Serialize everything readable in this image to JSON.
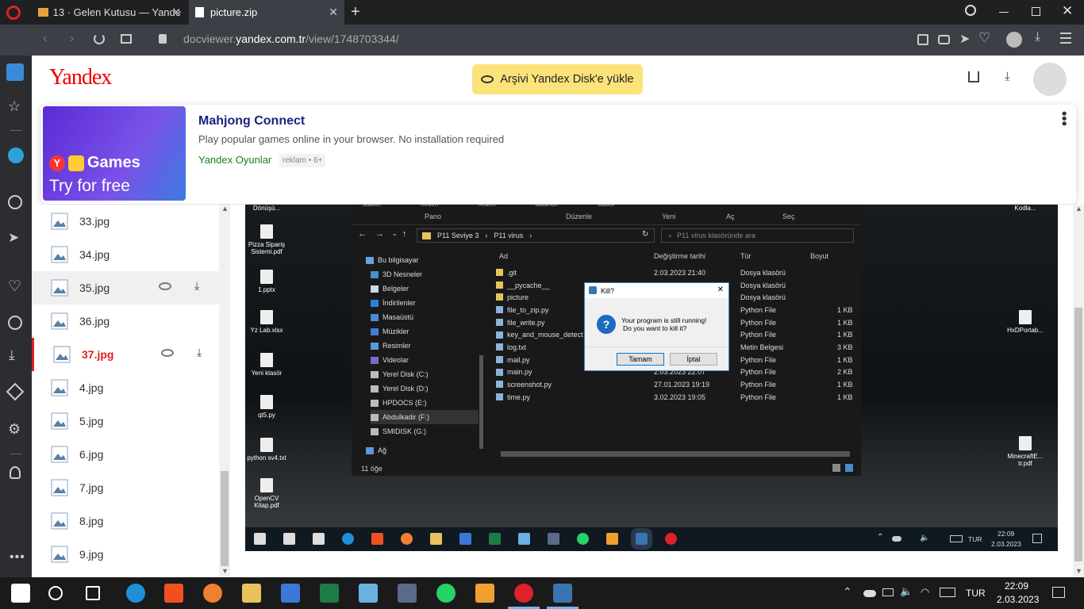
{
  "browser": {
    "tabs": [
      {
        "label": "13 · Gelen Kutusu — Yande",
        "active": false
      },
      {
        "label": "picture.zip",
        "active": true
      }
    ],
    "url_prefix": "docviewer.",
    "url_domain": "yandex.com.tr",
    "url_path": "/view/1748703344/"
  },
  "header": {
    "logo": "Yandex",
    "save_button": "Arşivi Yandex Disk'e yükle"
  },
  "ad": {
    "title": "Mahjong Connect",
    "description": "Play popular games online in your browser. No installation required",
    "source": "Yandex Oyunlar",
    "badge": "reklam • 6+",
    "image_brand": "Games",
    "image_cta": "Try for free"
  },
  "files": [
    {
      "name": "33.jpg"
    },
    {
      "name": "34.jpg"
    },
    {
      "name": "35.jpg",
      "state": "hover"
    },
    {
      "name": "36.jpg"
    },
    {
      "name": "37.jpg",
      "state": "current"
    },
    {
      "name": "4.jpg"
    },
    {
      "name": "5.jpg"
    },
    {
      "name": "6.jpg"
    },
    {
      "name": "7.jpg"
    },
    {
      "name": "8.jpg"
    },
    {
      "name": "9.jpg"
    }
  ],
  "screenshot": {
    "desktop_left": [
      {
        "label": "Dönüşü..."
      },
      {
        "label": "Pizza Sipariş Sistemi.pdf"
      },
      {
        "label": "1.pptx"
      },
      {
        "label": "Yz Lab.xlsx"
      },
      {
        "label": "Yeni klasör"
      },
      {
        "label": "qt5.py"
      },
      {
        "label": "python sv4.txt"
      },
      {
        "label": "OpenCV Kitap.pdf"
      }
    ],
    "desktop_right": [
      {
        "label": "Kodla..."
      },
      {
        "label": "HxDPortab..."
      },
      {
        "label": "MinecraftE... tr.pdf"
      }
    ],
    "ribbon_groups": [
      "Pano",
      "Düzenle",
      "Yeni",
      "Aç",
      "Seç"
    ],
    "ribbon_top": [
      "sabitle",
      "neden",
      "neden",
      "adlandır",
      "klasör"
    ],
    "path": [
      "P11 Seviye 3",
      "P11 virus"
    ],
    "search_placeholder": "P11 virus klasöründe ara",
    "nav": [
      "Bu bilgisayar",
      "3D Nesneler",
      "Belgeler",
      "İndirilenler",
      "Masaüstü",
      "Müzikler",
      "Resimler",
      "Videolar",
      "Yerel Disk (C:)",
      "Yerel Disk (D:)",
      "HPDOCS (E:)",
      "Abdulkadir (F:)",
      "SMIDISK (G:)",
      "Ağ"
    ],
    "columns": [
      "Ad",
      "Değiştirme tarihi",
      "Tür",
      "Boyut"
    ],
    "rows": [
      {
        "name": ".git",
        "date": "2.03.2023 21:40",
        "type": "Dosya klasörü",
        "size": ""
      },
      {
        "name": "__pycache__",
        "date": "",
        "type": "Dosya klasörü",
        "size": ""
      },
      {
        "name": "picture",
        "date": "",
        "type": "Dosya klasörü",
        "size": ""
      },
      {
        "name": "file_to_zip.py",
        "date": "",
        "type": "Python File",
        "size": "1 KB"
      },
      {
        "name": "file_write.py",
        "date": "",
        "type": "Python File",
        "size": "1 KB"
      },
      {
        "name": "key_and_mouse_detect",
        "date": "",
        "type": "Python File",
        "size": "1 KB"
      },
      {
        "name": "log.txt",
        "date": "",
        "type": "Metin Belgesi",
        "size": "3 KB"
      },
      {
        "name": "mail.py",
        "date": "",
        "type": "Python File",
        "size": "1 KB"
      },
      {
        "name": "main.py",
        "date": "2.03.2023 22:07",
        "type": "Python File",
        "size": "2 KB"
      },
      {
        "name": "screenshot.py",
        "date": "27.01.2023 19:19",
        "type": "Python File",
        "size": "1 KB"
      },
      {
        "name": "time.py",
        "date": "3.02.2023 19:05",
        "type": "Python File",
        "size": "1 KB"
      }
    ],
    "item_count": "11 öğe",
    "dialog": {
      "title": "Kill?",
      "message_line1": "Your program is still running!",
      "message_line2": "Do you want to kill it?",
      "ok": "Tamam",
      "cancel": "İptal"
    },
    "taskbar_lang": "TUR",
    "taskbar_time": "22:09",
    "taskbar_date": "2.03.2023"
  },
  "taskbar": {
    "lang": "TUR",
    "time": "22:09",
    "date": "2.03.2023"
  },
  "colors": {
    "accent_yellow": "#fbe37a",
    "current_file": "#e02020",
    "ad_link": "#1a7f1a"
  }
}
